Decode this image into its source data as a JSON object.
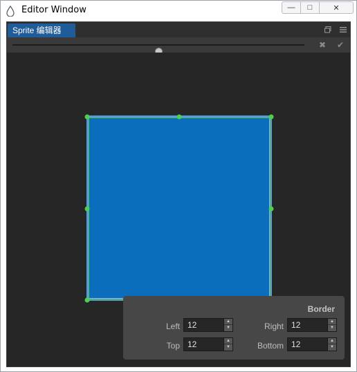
{
  "window": {
    "title": "Editor Window",
    "icon": "droplet-icon",
    "controls": {
      "minimize": "—",
      "maximize": "□",
      "close": "✕"
    }
  },
  "panel": {
    "tab_label": "Sprite 编辑器",
    "tab_icons": [
      "restore-window-icon",
      "menu-icon"
    ]
  },
  "toolbar": {
    "zoom_slider_value": 0.5,
    "cancel_icon": "✖",
    "confirm_icon": "✔"
  },
  "colors": {
    "sprite_fill": "#0a6ebd",
    "guide": "#47c04b",
    "tab_active": "#1f5c99"
  },
  "border": {
    "title": "Border",
    "left": {
      "label": "Left",
      "value": "12"
    },
    "right": {
      "label": "Right",
      "value": "12"
    },
    "top": {
      "label": "Top",
      "value": "12"
    },
    "bottom": {
      "label": "Bottom",
      "value": "12"
    }
  }
}
